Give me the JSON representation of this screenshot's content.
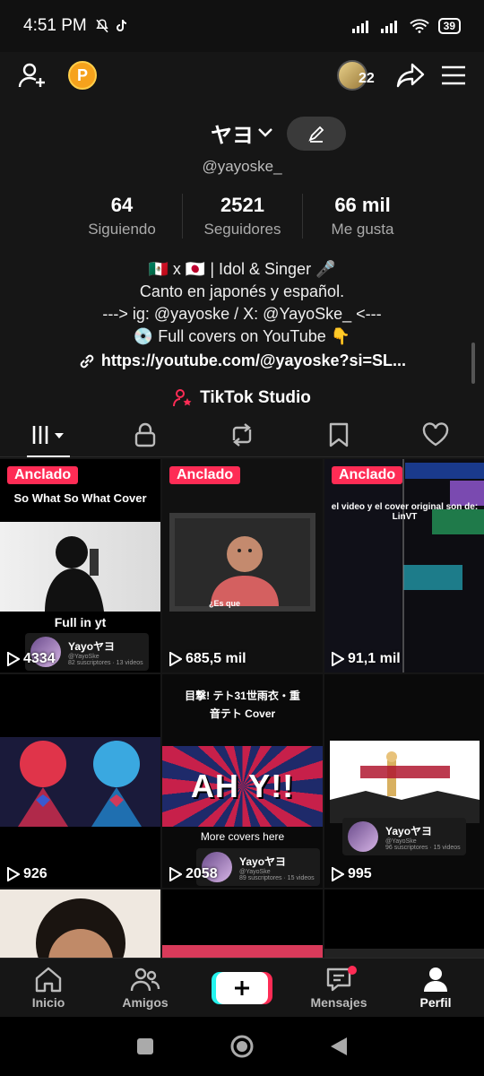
{
  "status": {
    "time": "4:51 PM",
    "battery": "39"
  },
  "profile": {
    "name": "ヤヨ",
    "handle": "@yayoske_",
    "stats": [
      {
        "value": "64",
        "label": "Siguiendo"
      },
      {
        "value": "2521",
        "label": "Seguidores"
      },
      {
        "value": "66 mil",
        "label": "Me gusta"
      }
    ],
    "bio": [
      "🇲🇽 x 🇯🇵 | Idol & Singer 🎤",
      "Canto en japonés y español.",
      "---> ig: @yayoske / X: @YayoSke_ <---",
      "💿 Full covers on YouTube 👇"
    ],
    "link": "https://youtube.com/@yayoske?si=SL...",
    "studio": "TikTok Studio"
  },
  "top_nav": {
    "coin_label": "P",
    "notification_count": "22"
  },
  "videos": [
    {
      "pinned": "Anclado",
      "views": "4334",
      "title": "So What So What Cover",
      "bottom_text": "Full in yt",
      "yt_name": "Yayoヤヨ",
      "yt_handle": "@YayoSke",
      "yt_meta": "82 suscriptores · 13 videos",
      "bg": "#fafafa"
    },
    {
      "pinned": "Anclado",
      "views": "685,5 mil",
      "caption": "¿Es que",
      "bg": "#1d1d1d"
    },
    {
      "pinned": "Anclado",
      "views": "91,1 mil",
      "title": "el video y el cover original son de: LinVT",
      "bg": "#0d0d12"
    },
    {
      "views": "926",
      "bg": "#000"
    },
    {
      "views": "2058",
      "title": "目撃! テト31世雨衣・重音テト Cover",
      "middle_text": "AH Y!!",
      "bottom_text": "More covers here",
      "yt_name": "Yayoヤヨ",
      "yt_handle": "@YayoSke",
      "yt_meta": "89 suscriptores · 15 videos",
      "bg": "#0a0a0a"
    },
    {
      "views": "995",
      "yt_name": "Yayoヤヨ",
      "yt_handle": "@YayoSke",
      "yt_meta": "96 suscriptores · 15 videos",
      "bg": "#0a0a0a"
    },
    {
      "views": "",
      "bg": "#2a1d14"
    },
    {
      "views": "",
      "bg": "#000"
    },
    {
      "views": "",
      "bg": "#000"
    }
  ],
  "bottom_nav": [
    {
      "label": "Inicio"
    },
    {
      "label": "Amigos"
    },
    {
      "label": ""
    },
    {
      "label": "Mensajes"
    },
    {
      "label": "Perfil"
    }
  ],
  "colors": {
    "accent": "#fe2c55",
    "cyan": "#25f4ee",
    "background": "#161616"
  }
}
